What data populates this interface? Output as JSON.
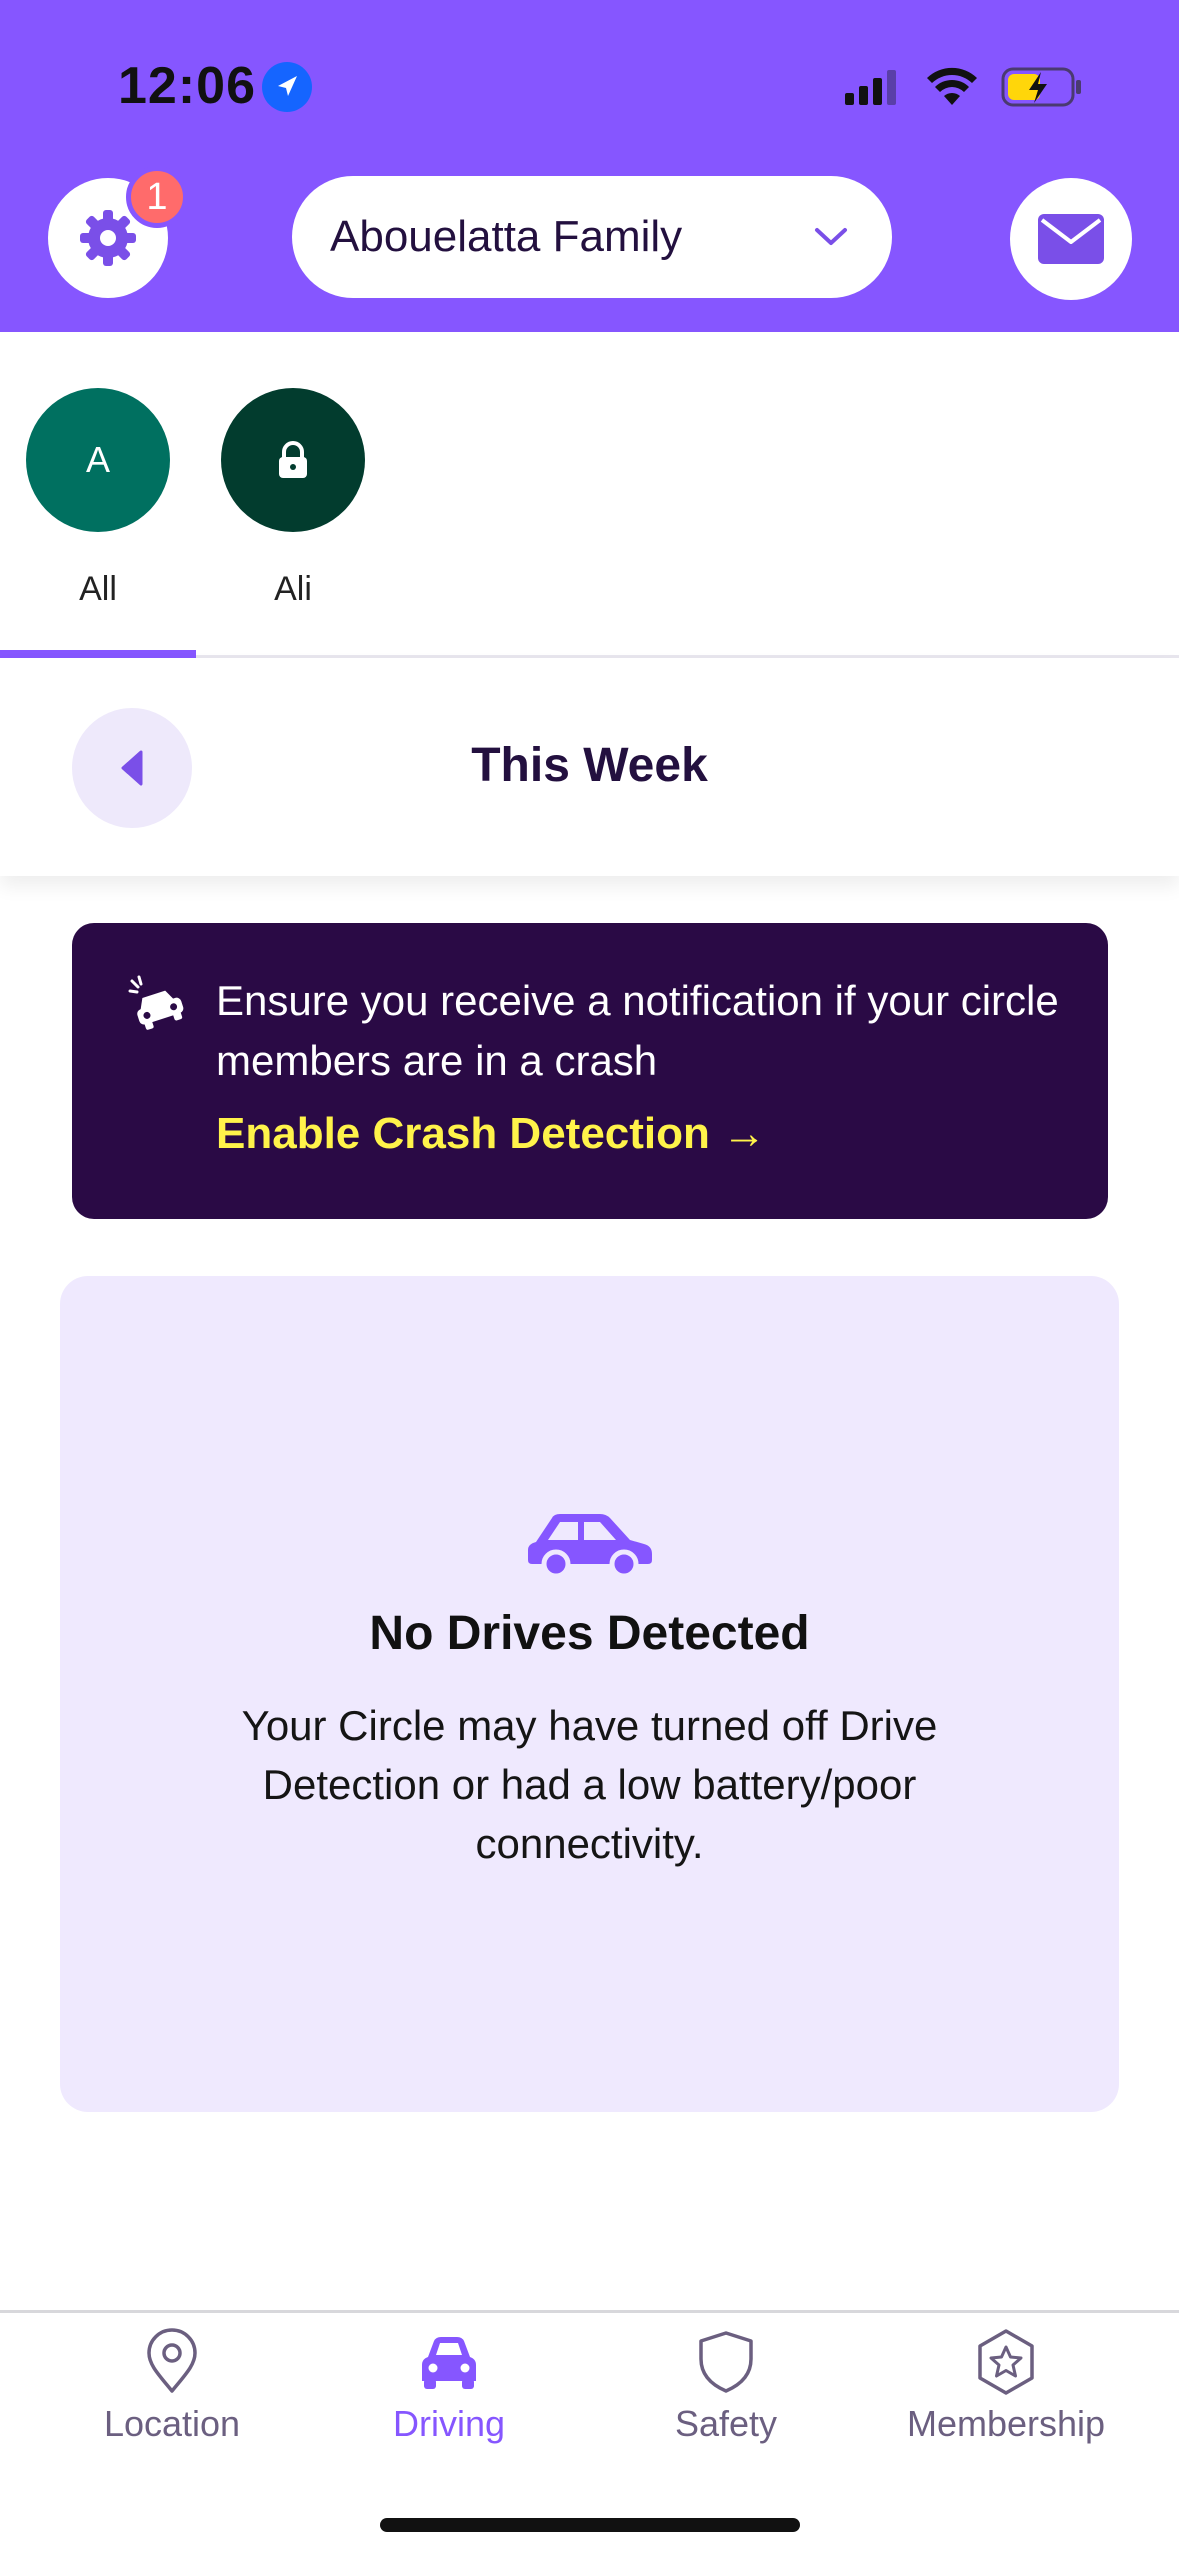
{
  "status_bar": {
    "time": "12:06"
  },
  "header": {
    "settings_badge_count": "1",
    "circle_name": "Abouelatta Family",
    "colors": {
      "header_bg": "#8656ff",
      "badge": "#ff6b6b"
    }
  },
  "members": [
    {
      "avatar_text": "A",
      "name": "All",
      "avatar_color": "#007060",
      "selected": true
    },
    {
      "avatar_text": "",
      "name": "Ali",
      "avatar_color": "#023c2e",
      "locked": true
    }
  ],
  "week": {
    "title": "This Week"
  },
  "crash_banner": {
    "message": "Ensure you receive a notification if your circle members are in a crash",
    "link_text": "Enable Crash Detection →"
  },
  "empty_state": {
    "title": "No Drives Detected",
    "description": "Your Circle may have turned off Drive Detection or had a low battery/poor connectivity."
  },
  "bottom_nav": {
    "items": [
      {
        "label": "Location",
        "icon": "location-pin-icon"
      },
      {
        "label": "Driving",
        "icon": "car-icon",
        "active": true
      },
      {
        "label": "Safety",
        "icon": "shield-icon"
      },
      {
        "label": "Membership",
        "icon": "star-badge-icon"
      }
    ]
  }
}
